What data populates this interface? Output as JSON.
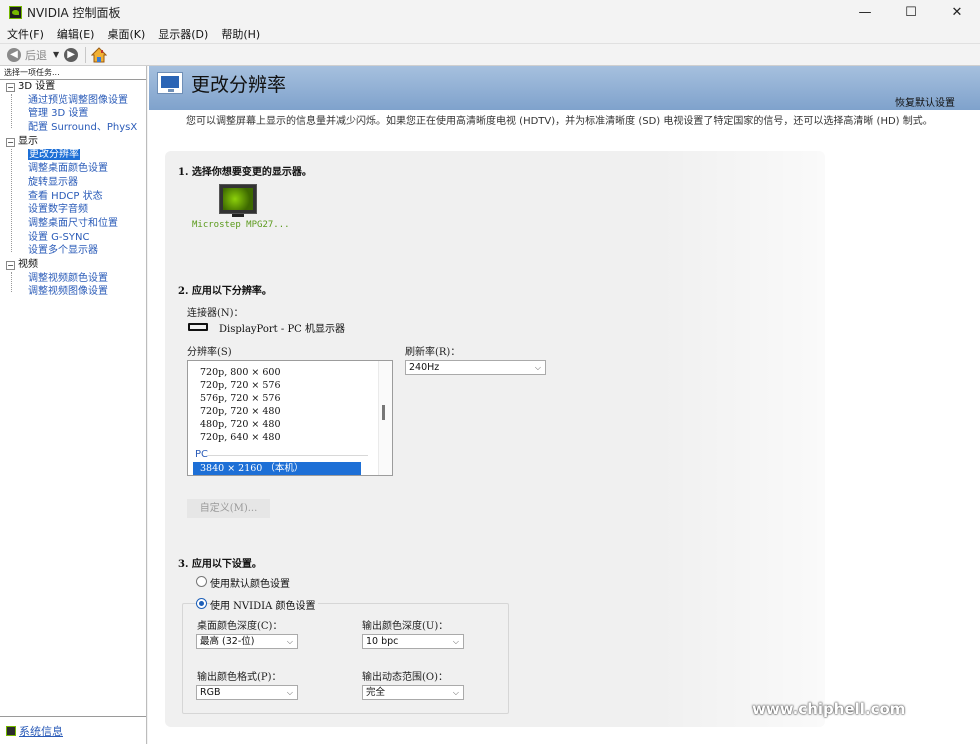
{
  "window": {
    "title": "NVIDIA 控制面板",
    "controls": {
      "minimize": "—",
      "maximize": "☐",
      "close": "✕"
    }
  },
  "menu": [
    "文件(F)",
    "编辑(E)",
    "桌面(K)",
    "显示器(D)",
    "帮助(H)"
  ],
  "toolbar": {
    "back_label": "后退"
  },
  "sidebar": {
    "header": "选择一项任务...",
    "categories": [
      {
        "label": "3D 设置",
        "items": [
          "通过预览调整图像设置",
          "管理 3D 设置",
          "配置 Surround、PhysX"
        ]
      },
      {
        "label": "显示",
        "items": [
          "更改分辨率",
          "调整桌面颜色设置",
          "旋转显示器",
          "查看 HDCP 状态",
          "设置数字音频",
          "调整桌面尺寸和位置",
          "设置 G-SYNC",
          "设置多个显示器"
        ]
      },
      {
        "label": "视频",
        "items": [
          "调整视频颜色设置",
          "调整视频图像设置"
        ]
      }
    ],
    "active_item": "更改分辨率",
    "system_info": "系统信息"
  },
  "page": {
    "title": "更改分辨率",
    "restore_defaults": "恢复默认设置",
    "description": "您可以调整屏幕上显示的信息量并减少闪烁。如果您正在使用高清晰度电视 (HDTV)，并为标准清晰度 (SD) 电视设置了特定国家的信号，还可以选择高清晰 (HD) 制式。"
  },
  "section1": {
    "title": "1. 选择你想要变更的显示器。",
    "monitor_label": "Microstep MPG27..."
  },
  "section2": {
    "title": "2. 应用以下分辨率。",
    "connector_label": "连接器(N)：",
    "connector_value": "DisplayPort - PC 机显示器",
    "resolution_label": "分辨率(S)",
    "resolutions": [
      "720p, 800 × 600",
      "720p, 720 × 576",
      "576p, 720 × 576",
      "720p, 720 × 480",
      "480p, 720 × 480",
      "720p, 640 × 480"
    ],
    "group_label": "PC",
    "selected_resolution": "3840 × 2160 （本机）",
    "refresh_label": "刷新率(R)：",
    "refresh_value": "240Hz",
    "custom_button": "自定义(M)..."
  },
  "section3": {
    "title": "3. 应用以下设置。",
    "option_default": "使用默认颜色设置",
    "option_nvidia": "使用 NVIDIA 颜色设置",
    "selected_option": "nvidia",
    "desktop_depth_label": "桌面颜色深度(C)：",
    "desktop_depth_value": "最高 (32-位)",
    "output_depth_label": "输出颜色深度(U)：",
    "output_depth_value": "10 bpc",
    "output_format_label": "输出颜色格式(P)：",
    "output_format_value": "RGB",
    "dynamic_range_label": "输出动态范围(O)：",
    "dynamic_range_value": "完全"
  },
  "watermark": {
    "site": "www.chiphell.com"
  }
}
